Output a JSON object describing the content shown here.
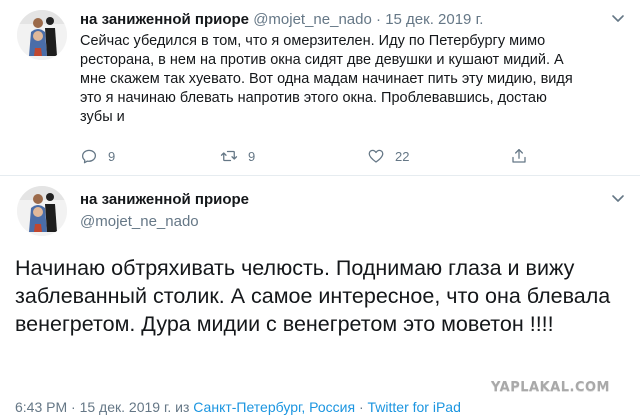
{
  "tweet1": {
    "display_name": "на заниженной приоре",
    "handle": "@mojet_ne_nado",
    "separator": "·",
    "date": "15 дек. 2019 г.",
    "text": "Сейчас убедился в том, что я омерзителен. Иду по Петербургу мимо\nресторана, в нем на против окна сидят две девушки и кушают мидий. А\nмне скажем так хуевато. Вот одна мадам начинает пить эту мидию, видя\nэто я начинаю блевать напротив этого окна. Проблевавшись, достаю\nзубы и",
    "reply_count": "9",
    "retweet_count": "9",
    "like_count": "22",
    "icons": [
      "chevron-down-icon",
      "reply-icon",
      "retweet-icon",
      "like-icon",
      "share-icon"
    ]
  },
  "tweet2": {
    "display_name": "на заниженной приоре",
    "handle": "@mojet_ne_nado",
    "text": "Начинаю обтряхивать челюсть. Поднимаю глаза и вижу заблеванный столик. А самое интересное, что она блевала венегретом. Дура мидии с венегретом это моветон !!!!",
    "time": "6:43 PM",
    "date": "15 дек. 2019 г.",
    "from_word": "из",
    "location": "Санкт-Петербург, Россия",
    "source": "Twitter for iPad",
    "separator": "·"
  },
  "watermark": "YAPLAKAL.COM",
  "colors": {
    "text": "#14171a",
    "muted": "#657786",
    "link": "#1b95e0",
    "border": "#e6ecf0"
  }
}
